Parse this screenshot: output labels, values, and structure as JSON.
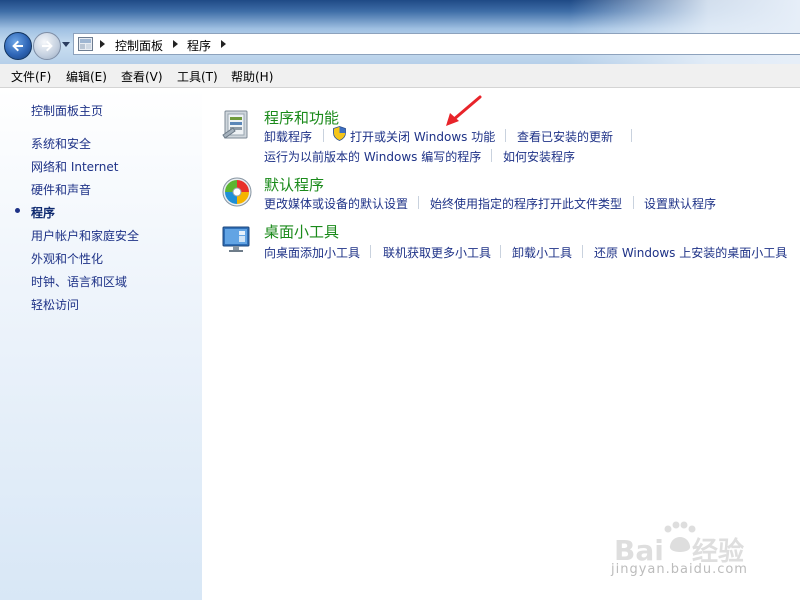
{
  "address": {
    "crumbs": [
      "控制面板",
      "程序"
    ]
  },
  "menu": [
    {
      "name": "menu-file",
      "label": "文件(F)"
    },
    {
      "name": "menu-edit",
      "label": "编辑(E)"
    },
    {
      "name": "menu-view",
      "label": "查看(V)"
    },
    {
      "name": "menu-tools",
      "label": "工具(T)"
    },
    {
      "name": "menu-help",
      "label": "帮助(H)"
    }
  ],
  "sidebar": {
    "home": "控制面板主页",
    "items": [
      "系统和安全",
      "网络和 Internet",
      "硬件和声音",
      "程序",
      "用户帐户和家庭安全",
      "外观和个性化",
      "时钟、语言和区域",
      "轻松访问"
    ],
    "current_index": 3
  },
  "categories": [
    {
      "title": "程序和功能",
      "icon": "programs-features-icon",
      "links_row1": [
        "卸载程序",
        "打开或关闭 Windows 功能",
        "查看已安装的更新"
      ],
      "links_row2": [
        "运行为以前版本的 Windows 编写的程序",
        "如何安装程序"
      ]
    },
    {
      "title": "默认程序",
      "icon": "default-programs-icon",
      "links_row1": [
        "更改媒体或设备的默认设置",
        "始终使用指定的程序打开此文件类型",
        "设置默认程序"
      ]
    },
    {
      "title": "桌面小工具",
      "icon": "desktop-gadgets-icon",
      "links_row1": [
        "向桌面添加小工具",
        "联机获取更多小工具",
        "卸载小工具",
        "还原 Windows 上安装的桌面小工具"
      ]
    }
  ],
  "colors": {
    "link": "#1e3287",
    "category_title": "#1a8a1a",
    "annotation_arrow": "#e8242a"
  },
  "watermark": {
    "logo": "Bai du 经验",
    "url": "jingyan.baidu.com"
  }
}
